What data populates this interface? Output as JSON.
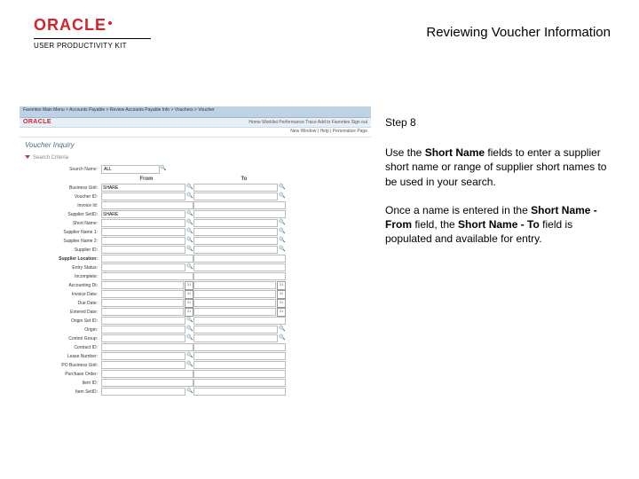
{
  "header": {
    "logo_text": "ORACLE",
    "logo_tagline": "USER PRODUCTIVITY KIT",
    "title": "Reviewing Voucher Information"
  },
  "screenshot": {
    "breadcrumb": "Favorites   Main Menu  >  Accounts Payable  >  Review Accounts Payable Info  >  Vouchers  >  Voucher",
    "topright": "Home   Worklist   Performance Trace   Add to Favorites   Sign out",
    "oracle_mini": "ORACLE",
    "newwindow": "New Window | Help | Personalize Page",
    "page_title": "Voucher Inquiry",
    "search_criteria": "Search Criteria",
    "sort_label": "Search Name:",
    "sort_value": "ALL",
    "col_from": "From",
    "col_to": "To",
    "rows": [
      {
        "label": "Business Unit:",
        "from": "SHARE",
        "fromLk": true,
        "to": "",
        "toLk": true
      },
      {
        "label": "Voucher ID:",
        "from": "",
        "fromLk": true,
        "to": "",
        "toLk": true
      },
      {
        "label": "Invoice Id:",
        "from": "",
        "fromLk": false,
        "to": "",
        "toLk": false
      },
      {
        "label": "Supplier SetID:",
        "from": "SHARE",
        "fromLk": true,
        "to": "",
        "toLk": false
      },
      {
        "label": "Short Name:",
        "from": "",
        "fromLk": true,
        "to": "",
        "toLk": true
      },
      {
        "label": "Supplier Name 1:",
        "from": "",
        "fromLk": true,
        "to": "",
        "toLk": true
      },
      {
        "label": "Supplier Name 2:",
        "from": "",
        "fromLk": true,
        "to": "",
        "toLk": true
      },
      {
        "label": "Supplier ID:",
        "from": "",
        "fromLk": true,
        "to": "",
        "toLk": true
      },
      {
        "label": "Supplier Location:",
        "from": "",
        "fromLk": false,
        "to": "",
        "toLk": false,
        "section": true
      },
      {
        "label": "Entry Status:",
        "from": "",
        "fromLk": true,
        "to": "",
        "toLk": false
      },
      {
        "label": "Incomplete:",
        "from": "",
        "fromLk": false,
        "to": "",
        "toLk": false
      },
      {
        "label": "Accounting Dt:",
        "from": "",
        "fromCal": true,
        "to": "",
        "toCal": true
      },
      {
        "label": "Invoice Date:",
        "from": "",
        "fromCal": true,
        "to": "",
        "toCal": true
      },
      {
        "label": "Due Date:",
        "from": "",
        "fromCal": true,
        "to": "",
        "toCal": true
      },
      {
        "label": "Entered Date:",
        "from": "",
        "fromCal": true,
        "to": "",
        "toCal": true
      },
      {
        "label": "Origin Set ID:",
        "from": "",
        "fromLk": true,
        "to": "",
        "toLk": false
      },
      {
        "label": "Origin:",
        "from": "",
        "fromLk": true,
        "to": "",
        "toLk": true
      },
      {
        "label": "Control Group:",
        "from": "",
        "fromLk": true,
        "to": "",
        "toLk": true
      },
      {
        "label": "Contract ID:",
        "from": "",
        "fromLk": false,
        "to": "",
        "toLk": false
      },
      {
        "label": "Lease Number:",
        "from": "",
        "fromLk": true,
        "to": "",
        "toLk": false
      },
      {
        "label": "PO Business Unit:",
        "from": "",
        "fromLk": true,
        "to": "",
        "toLk": false
      },
      {
        "label": "Purchase Order:",
        "from": "",
        "fromLk": false,
        "to": "",
        "toLk": false
      },
      {
        "label": "Item ID:",
        "from": "",
        "fromLk": false,
        "to": "",
        "toLk": false
      },
      {
        "label": "Item SetID:",
        "from": "",
        "fromLk": true,
        "to": "",
        "toLk": false
      }
    ]
  },
  "instruction": {
    "step": "Step 8",
    "p1a": "Use the ",
    "p1b": "Short Name",
    "p1c": " fields to enter a supplier short name or range of supplier short names to be used in your search.",
    "p2a": "Once a name is entered in the ",
    "p2b": "Short Name - From",
    "p2c": " field, the ",
    "p2d": "Short Name - To",
    "p2e": " field is populated and available for entry."
  }
}
